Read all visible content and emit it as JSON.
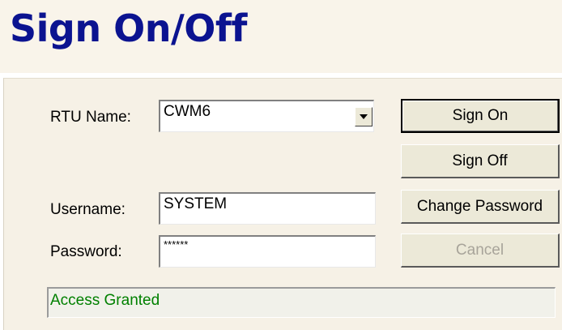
{
  "page": {
    "title": "Sign On/Off"
  },
  "form": {
    "rtu_label": "RTU Name:",
    "rtu_value": "CWM6",
    "username_label": "Username:",
    "username_value": "SYSTEM",
    "password_label": "Password:",
    "password_value": "******"
  },
  "buttons": {
    "sign_on": "Sign On",
    "sign_off": "Sign Off",
    "change_password": "Change Password",
    "cancel": "Cancel"
  },
  "status": {
    "message": "Access Granted",
    "color": "#008000"
  },
  "colors": {
    "title": "#0b1390",
    "panel": "#f6f1e6",
    "button_face": "#ece9d8"
  },
  "icons": {
    "dropdown": "triangle-down-icon"
  }
}
